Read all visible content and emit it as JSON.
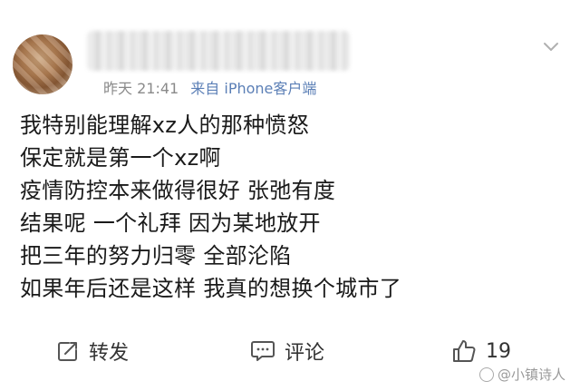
{
  "post": {
    "time": "昨天 21:41",
    "source": "来自 iPhone客户端",
    "lines": [
      "我特别能理解xz人的那种愤怒",
      "保定就是第一个xz啊",
      "疫情防控本来做得很好 张弛有度",
      "结果呢 一个礼拜 因为某地放开",
      "把三年的努力归零 全部沦陷",
      "如果年后还是这样 我真的想换个城市了"
    ]
  },
  "actions": {
    "repost_label": "转发",
    "comment_label": "评论",
    "like_count": "19"
  },
  "watermark": "@小镇诗人",
  "colors": {
    "text": "#1a1a1a",
    "meta": "#8a8a8a",
    "source": "#5b7fb6"
  }
}
